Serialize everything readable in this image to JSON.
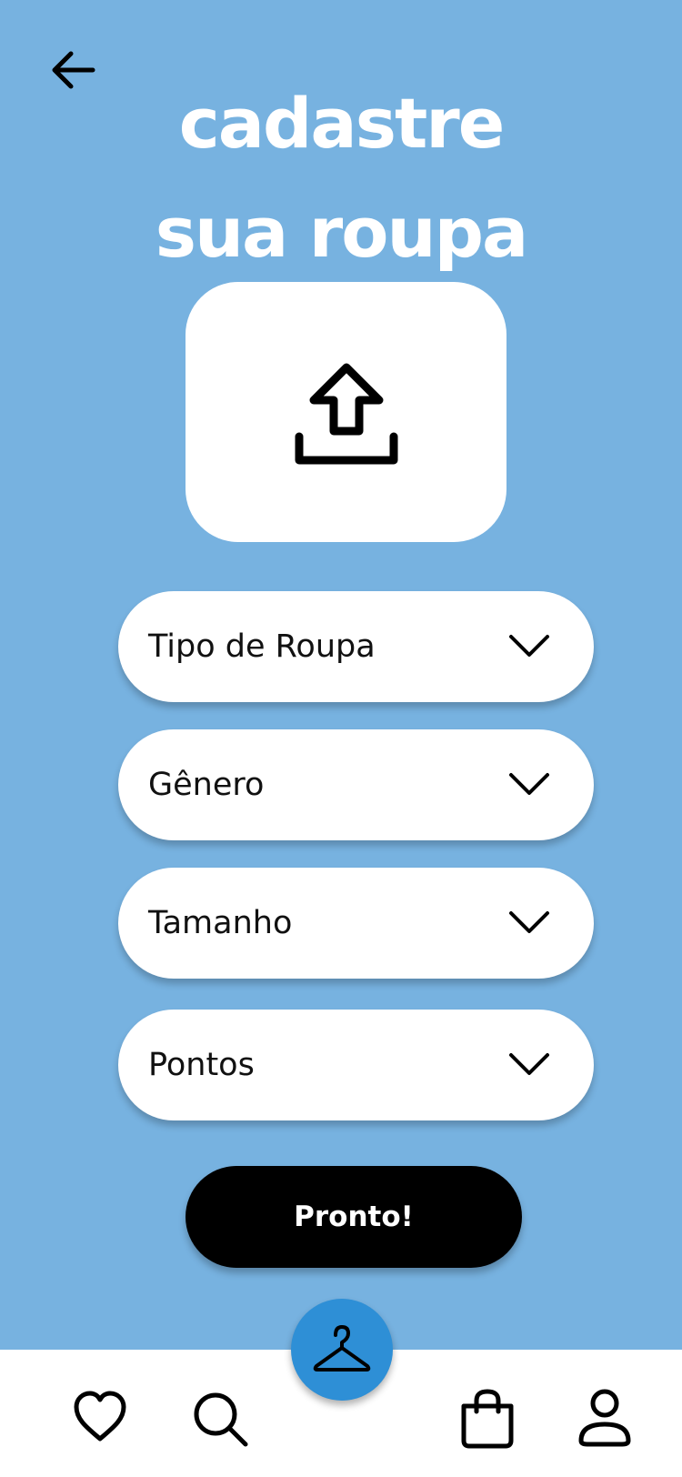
{
  "header": {
    "title_line1": "cadastre",
    "title_line2": "sua roupa"
  },
  "icons": {
    "back": "arrow-left-icon",
    "upload": "upload-icon",
    "dropdown": "chevron-down-icon",
    "favorites": "heart-icon",
    "search": "search-icon",
    "wardrobe": "hanger-icon",
    "bag": "shopping-bag-icon",
    "profile": "user-icon"
  },
  "form": {
    "selects": [
      {
        "label": "Tipo de Roupa"
      },
      {
        "label": "Gênero"
      },
      {
        "label": "Tamanho"
      },
      {
        "label": "Pontos"
      }
    ],
    "submit_label": "Pronto!"
  },
  "colors": {
    "background": "#77b2e0",
    "accent": "#2e8fd6",
    "button": "#000000",
    "surface": "#ffffff"
  }
}
